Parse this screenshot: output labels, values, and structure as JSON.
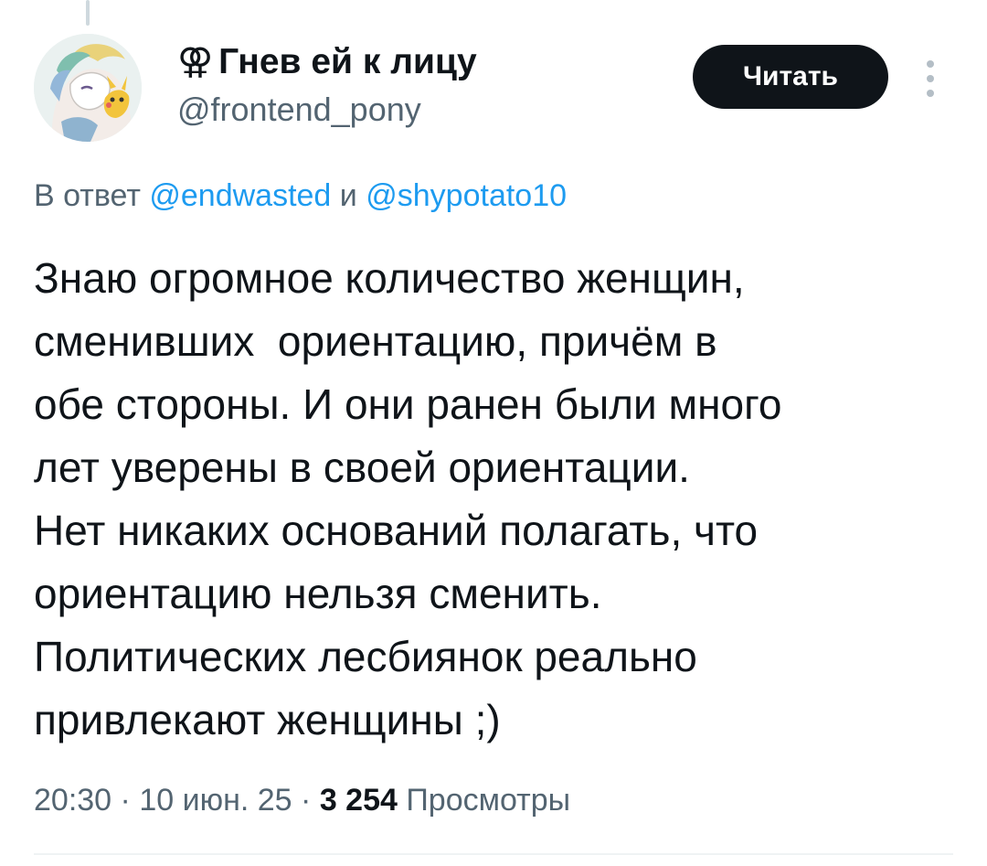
{
  "author": {
    "display_name": "Гнев ей к лицу",
    "name_glyph": "⚢",
    "handle": "@frontend_pony",
    "avatar_icon": "avatar-illustration"
  },
  "actions": {
    "follow_label": "Читать",
    "more_icon": "more-vertical-icon"
  },
  "reply": {
    "prefix": "В ответ",
    "mention_1": "@endwasted",
    "conjunction": "и",
    "mention_2": "@shypotato10"
  },
  "tweet": {
    "lines": [
      "Знаю огромное количество женщин,",
      "сменивших  ориентацию, причём в",
      "обе стороны. И они ранен были много",
      "лет уверены в своей ориентации.",
      "Нет никаких оснований полагать, что",
      "ориентацию нельзя сменить.",
      "Политических лесбиянок реально",
      "привлекают женщины ;)"
    ]
  },
  "meta": {
    "time": "20:30",
    "separator": "·",
    "date": "10 июн. 25",
    "views_count": "3 254",
    "views_label": "Просмотры"
  },
  "colors": {
    "text": "#0f1419",
    "secondary": "#536471",
    "link": "#1d9bf0",
    "button_bg": "#0f1419",
    "button_text": "#ffffff"
  }
}
